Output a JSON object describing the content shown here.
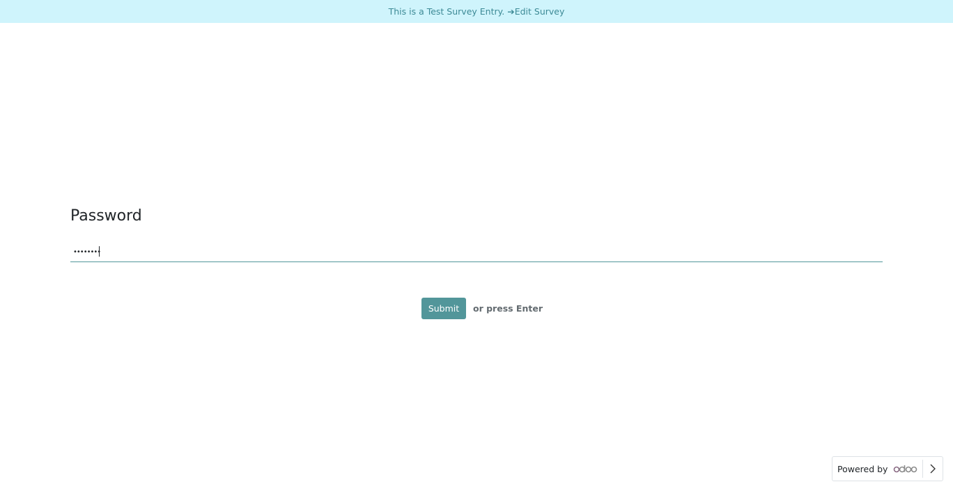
{
  "banner": {
    "text": "This is a Test Survey Entry.",
    "arrow": "➔",
    "edit_label": "Edit Survey"
  },
  "question": {
    "title": "Password",
    "value": "••••••••"
  },
  "actions": {
    "submit_label": "Submit",
    "enter_hint": "or press Enter"
  },
  "footer": {
    "powered_by": "Powered by",
    "logo_text": "odoo"
  },
  "colors": {
    "banner_bg": "#cff4fc",
    "banner_text": "#3d8a96",
    "primary": "#52969a"
  },
  "icons": {
    "arrow": "arrow-right-icon",
    "chevron": "chevron-right-icon"
  }
}
